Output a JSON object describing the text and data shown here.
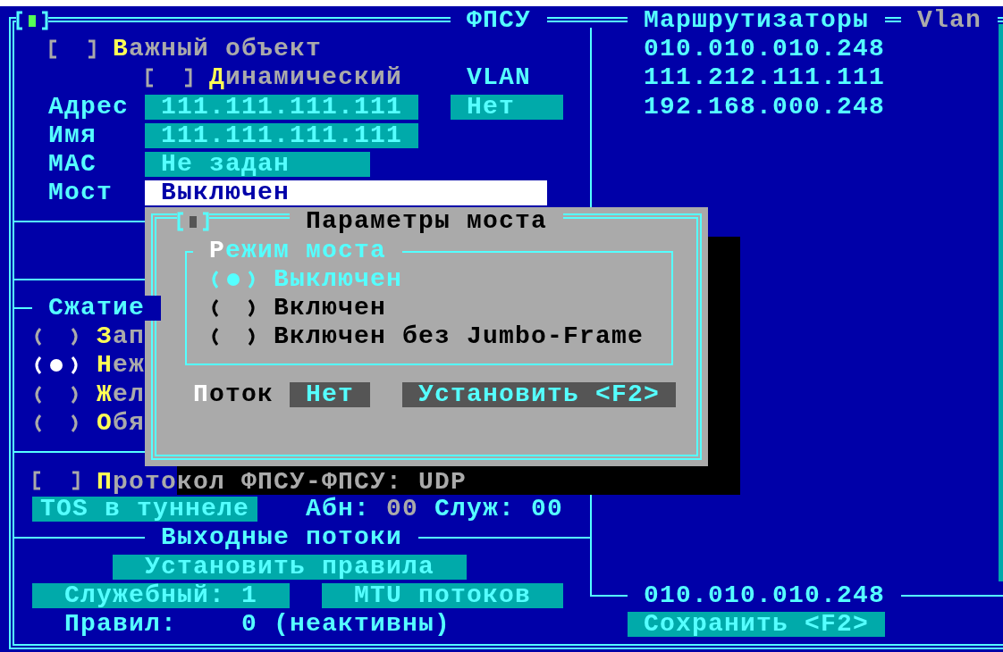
{
  "main_panel": {
    "title": "ФПСУ"
  },
  "important_object": {
    "label": "Важный объект",
    "checked": false
  },
  "dynamic": {
    "label": "Динамический",
    "checked": false
  },
  "vlan": {
    "label": "VLAN",
    "value": "Нет"
  },
  "fields": [
    {
      "label": "Адрес",
      "value": "111.111.111.111",
      "focused": false
    },
    {
      "label": "Имя",
      "value": "111.111.111.111",
      "focused": false
    },
    {
      "label": "MAC",
      "value": "Не задан",
      "focused": false
    },
    {
      "label": "Мост",
      "value": "Выключен",
      "focused": true
    }
  ],
  "compression": {
    "title": "Сжатие",
    "options": [
      {
        "label": "Зап",
        "selected": false
      },
      {
        "label": "Неж",
        "selected": true
      },
      {
        "label": "Жел",
        "selected": false
      },
      {
        "label": "Обя",
        "selected": false
      }
    ]
  },
  "protocol": {
    "label": "Протокол ФПСУ-ФПСУ: UDP",
    "checked": false
  },
  "tos_button": "TOS в туннеле",
  "abn": {
    "label": "Абн:",
    "value": "00"
  },
  "sluzh": {
    "label": "Служ:",
    "value": "00"
  },
  "output_flows": {
    "title": "Выходные потоки",
    "rules_button": "Установить правила",
    "service_button": "Служебный: 1",
    "mtu_button": "MTU потоков",
    "rules_label": "Правил:",
    "rules_value": "0 (неактивны)"
  },
  "routers": {
    "title": "Маршрутизаторы",
    "vlan_title": "Vlan",
    "items": [
      "010.010.010.248",
      "111.212.111.111",
      "192.168.000.248"
    ],
    "bottom_title": "010.010.010.248",
    "save_button": "Сохранить <F2>"
  },
  "dialog": {
    "title": "Параметры моста",
    "group_title": "Режим моста",
    "options": [
      {
        "label": "Выключен",
        "selected": true
      },
      {
        "label": "Включен",
        "selected": false
      },
      {
        "label": "Включен без Jumbo-Frame",
        "selected": false
      }
    ],
    "flow_label": "Поток",
    "flow_value": "Нет",
    "set_button": "Установить <F2>"
  }
}
